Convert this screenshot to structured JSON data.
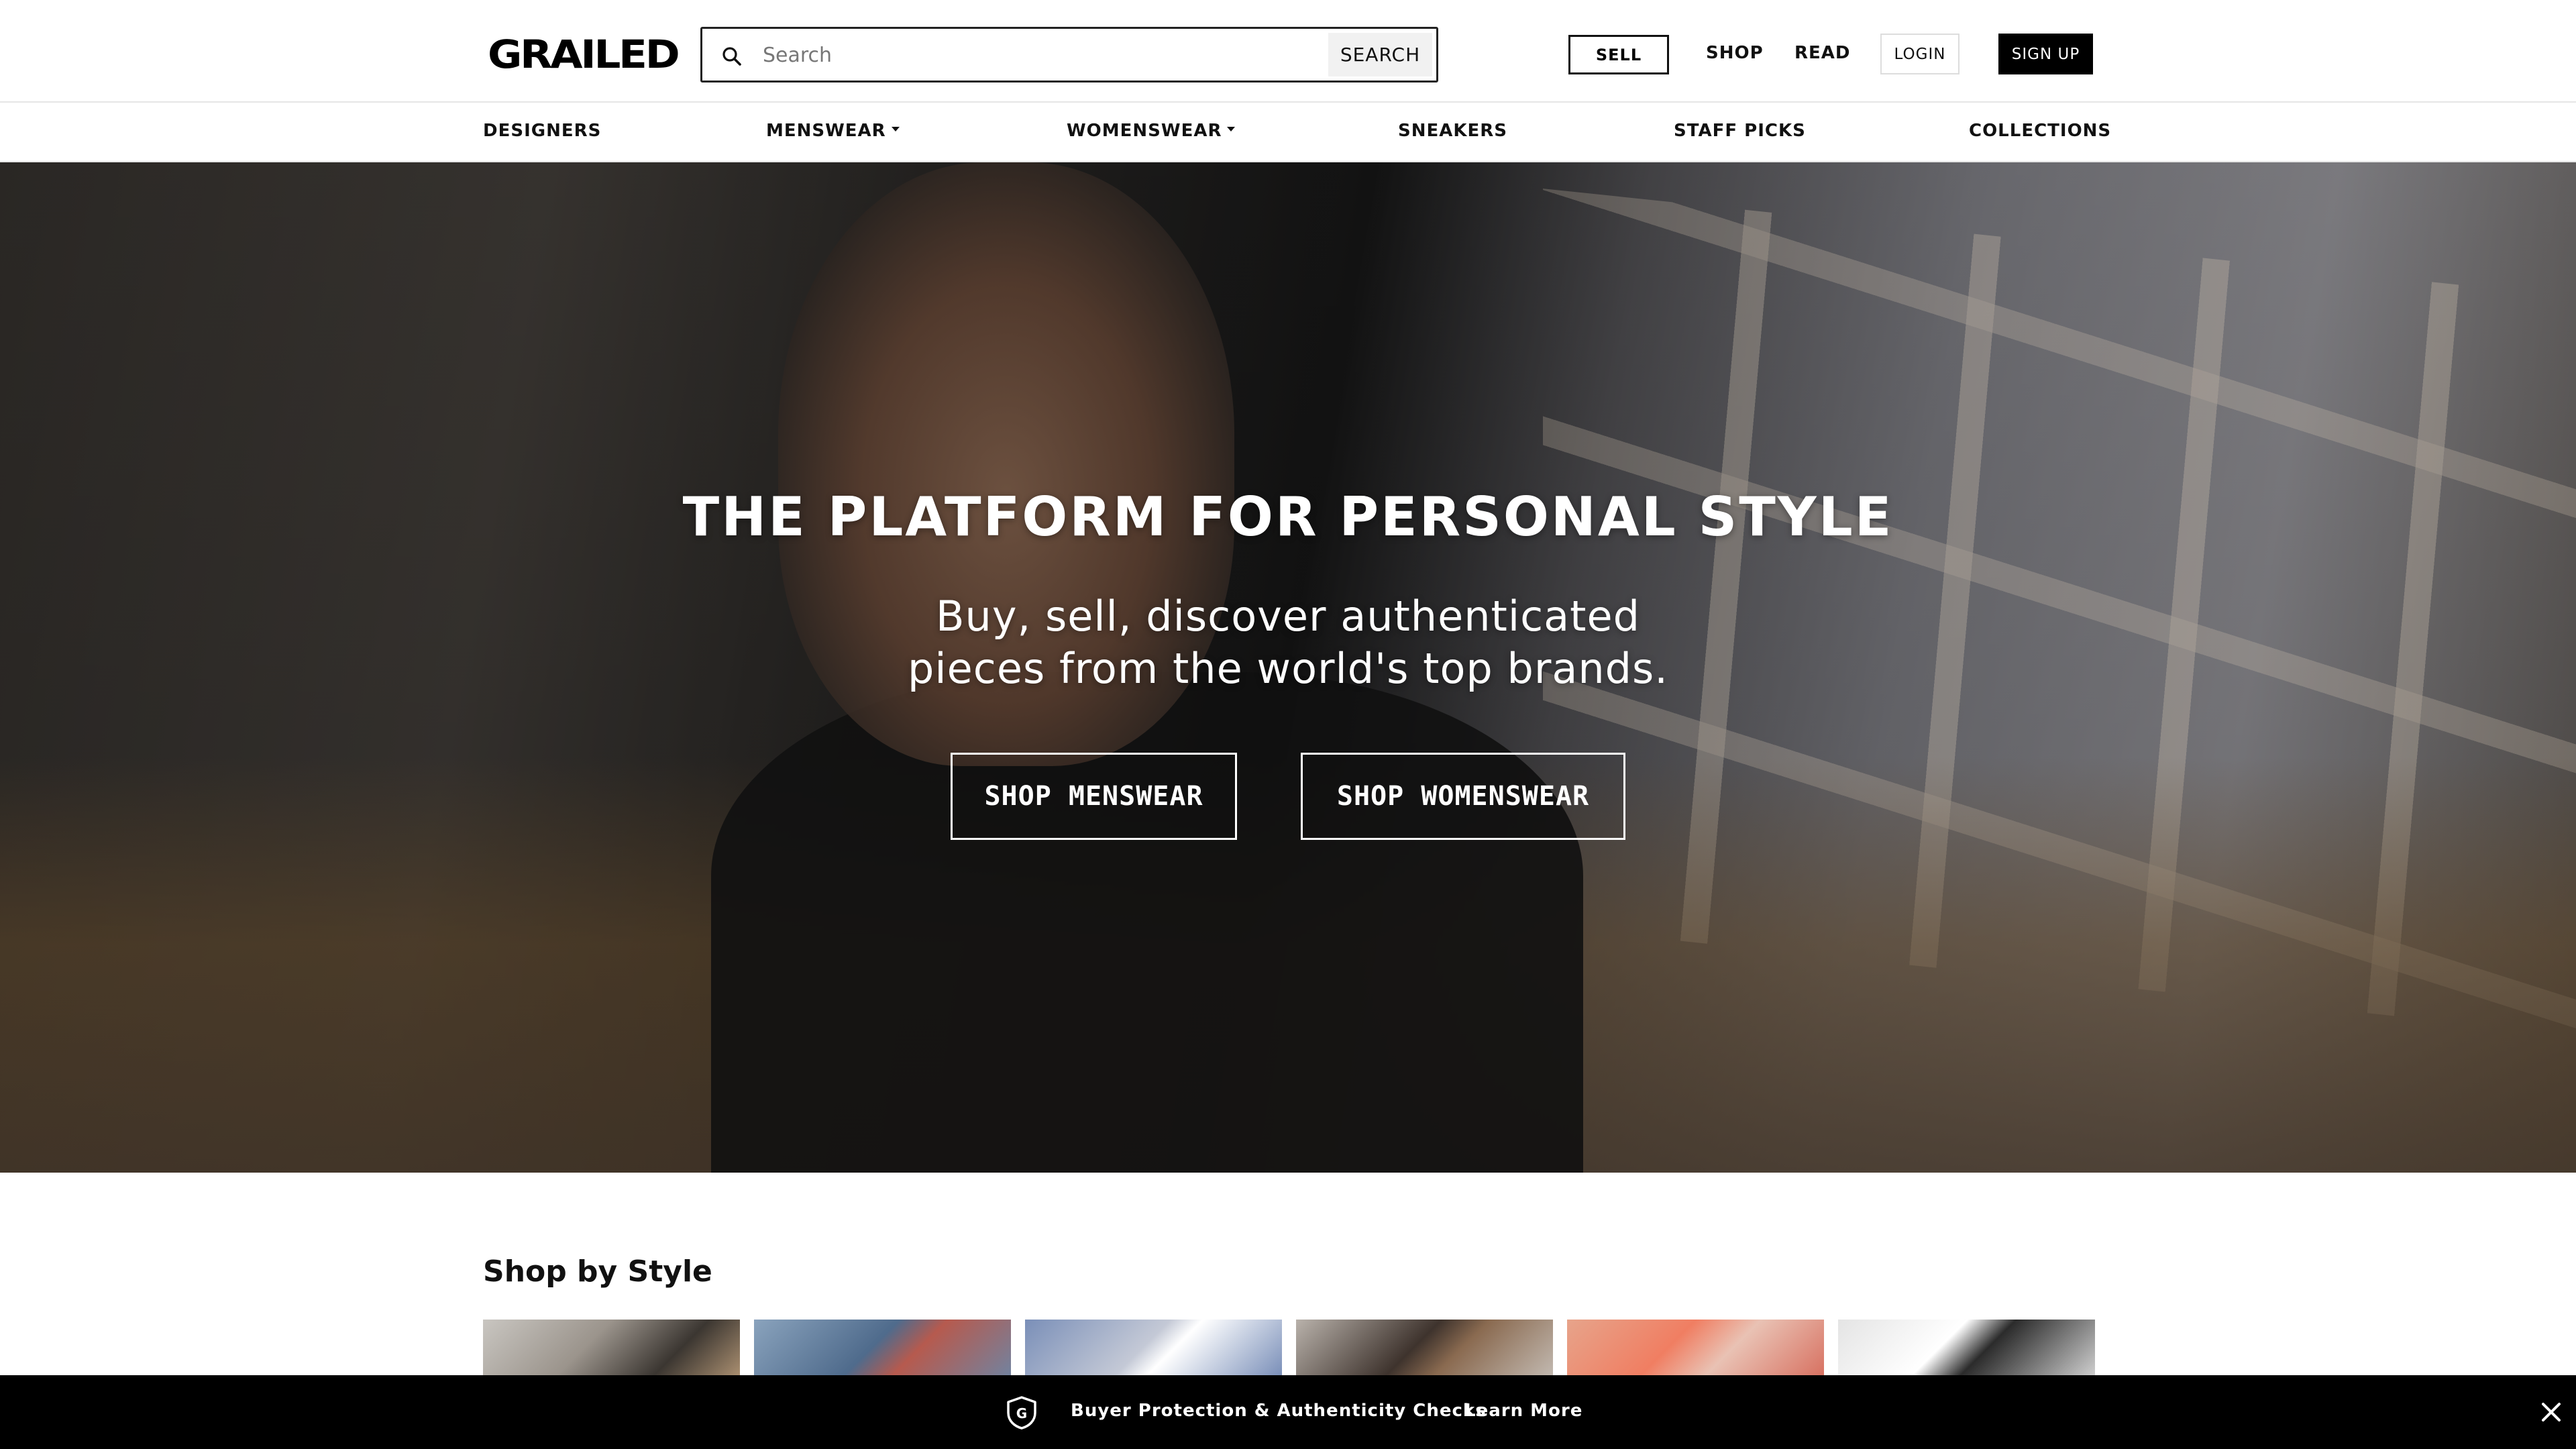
{
  "header": {
    "logo": "GRAILED",
    "search": {
      "placeholder": "Search",
      "button_label": "SEARCH"
    },
    "sell_label": "SELL",
    "shop_label": "SHOP",
    "read_label": "READ",
    "login_label": "LOGIN",
    "signup_label": "SIGN UP"
  },
  "category_nav": {
    "items": [
      {
        "label": "DESIGNERS",
        "has_dropdown": false
      },
      {
        "label": "MENSWEAR",
        "has_dropdown": true
      },
      {
        "label": "WOMENSWEAR",
        "has_dropdown": true
      },
      {
        "label": "SNEAKERS",
        "has_dropdown": false
      },
      {
        "label": "STAFF PICKS",
        "has_dropdown": false
      },
      {
        "label": "COLLECTIONS",
        "has_dropdown": false
      }
    ]
  },
  "hero": {
    "title": "THE PLATFORM FOR PERSONAL STYLE",
    "subtitle_line1": "Buy, sell, discover authenticated",
    "subtitle_line2": "pieces from the world's top brands.",
    "cta_mens": "SHOP MENSWEAR",
    "cta_womens": "SHOP WOMENSWEAR"
  },
  "shop_by_style": {
    "title": "Shop by Style",
    "card_count": 6
  },
  "banner": {
    "text": "Buyer Protection & Authenticity Checks",
    "link": "Learn More",
    "icon": "shield-g-icon"
  },
  "colors": {
    "primary": "#000000",
    "background": "#ffffff",
    "banner": "#000000",
    "border": "#e6e6e6"
  }
}
